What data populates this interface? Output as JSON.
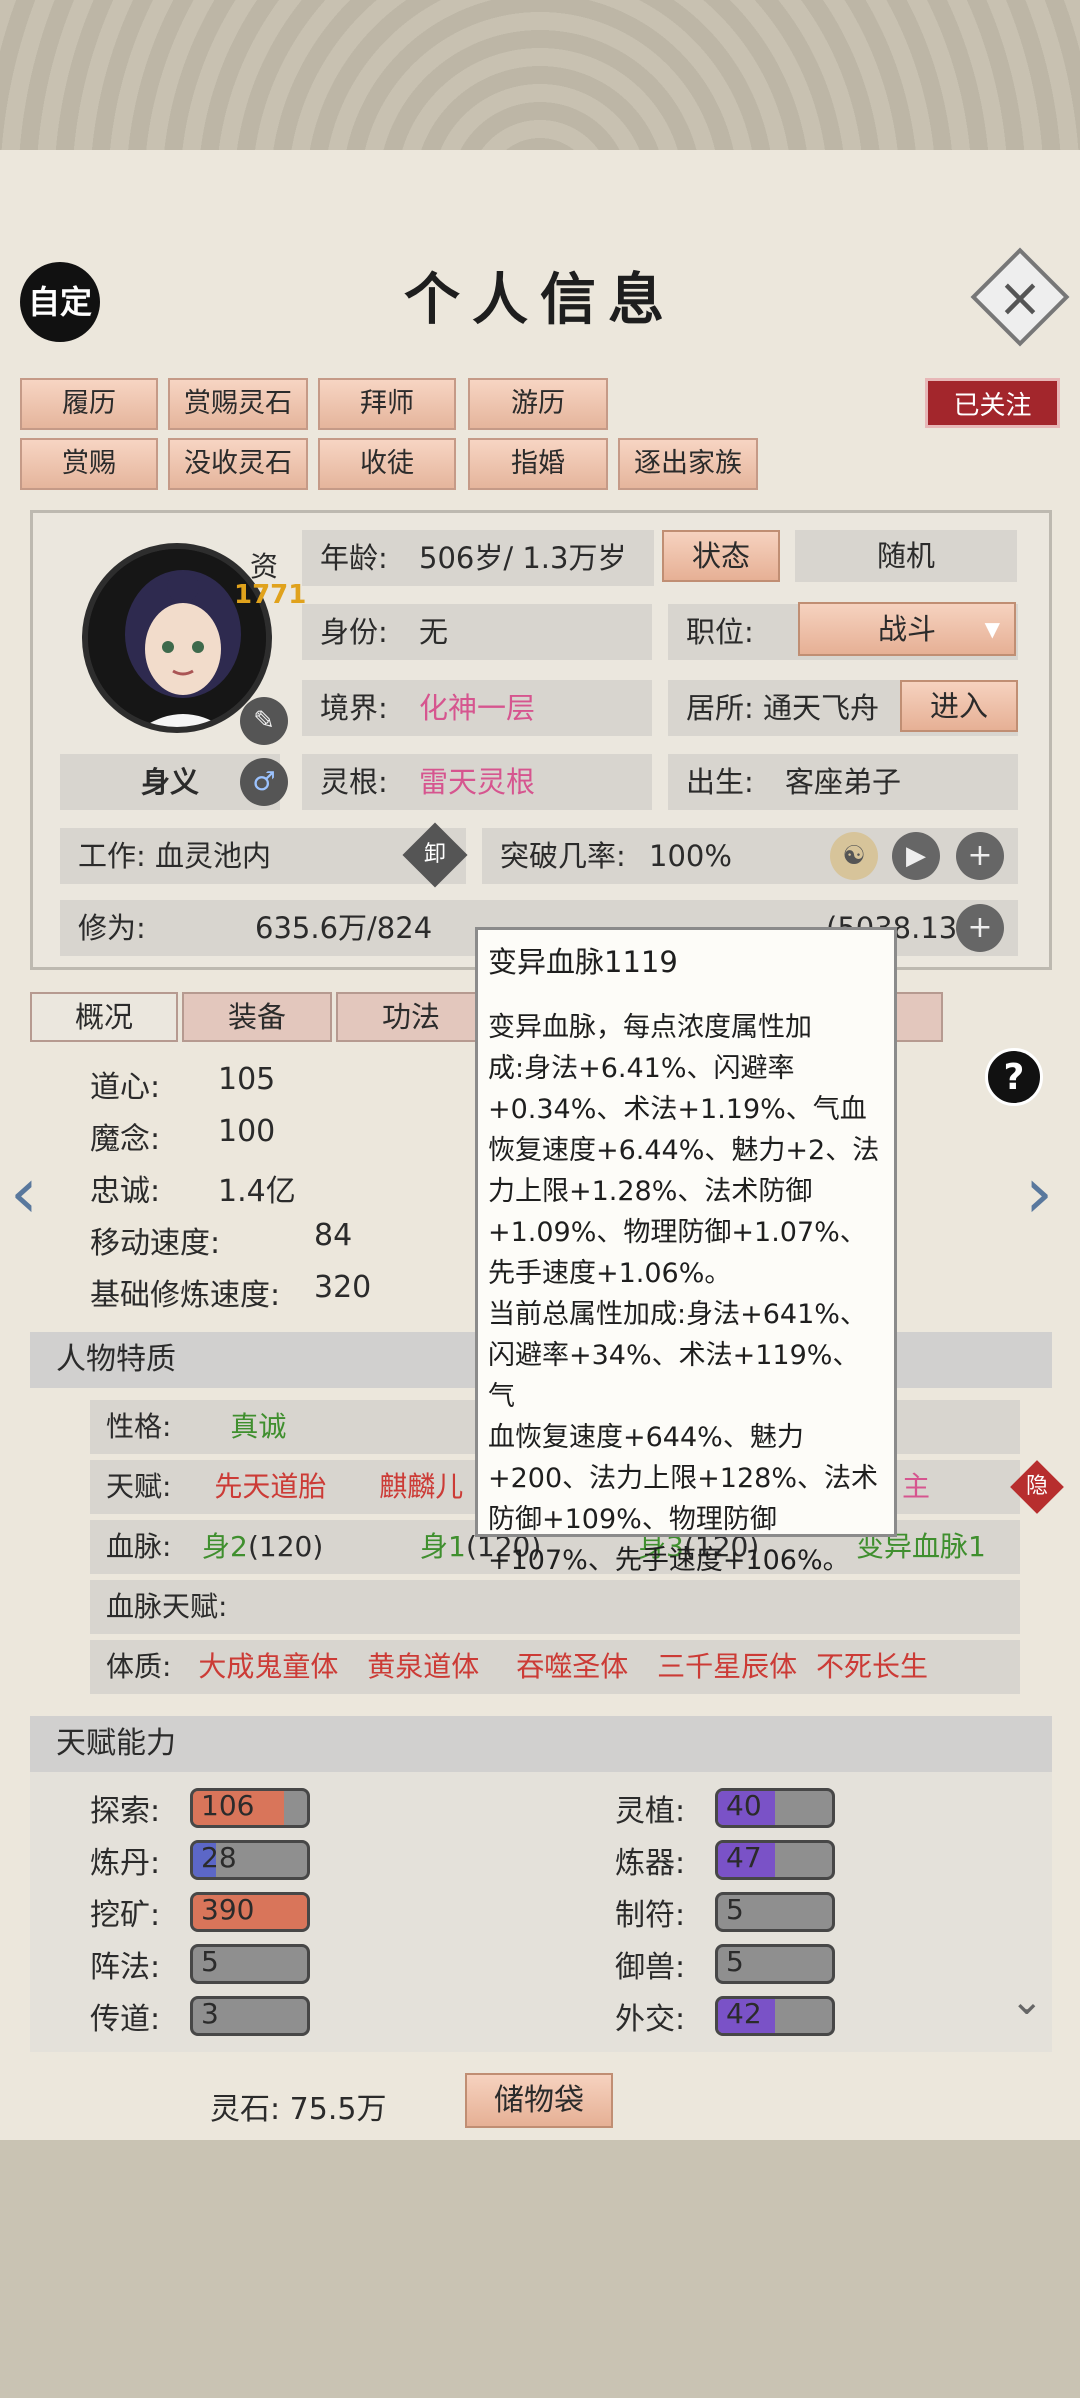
{
  "header": {
    "title": "个人信息",
    "auto_label": "自定",
    "close_icon": "close-icon",
    "follow_label": "已关注"
  },
  "actions": [
    "履历",
    "赏赐灵石",
    "拜师",
    "游历",
    "赏赐",
    "没收灵石",
    "收徒",
    "指婚",
    "逐出家族"
  ],
  "profile": {
    "aptitude_label": "资",
    "aptitude_value": "1771",
    "name": "身义",
    "gender_icon": "male-icon",
    "age_label": "年龄:",
    "age_value": "506岁/ 1.3万岁",
    "status_button": "状态",
    "random_button": "随机",
    "identity_label": "身份:",
    "identity_value": "无",
    "position_label": "职位:",
    "position_value": "战斗",
    "realm_label": "境界:",
    "realm_value": "化神一层",
    "residence_label": "居所:",
    "residence_value": "通天飞舟",
    "enter_button": "进入",
    "root_label": "灵根:",
    "root_value": "雷天灵根",
    "birth_label": "出生:",
    "birth_value": "客座弟子",
    "work_label": "工作:",
    "work_value": "血灵池内",
    "work_badge": "卸",
    "breakthrough_label": "突破几率:",
    "breakthrough_value": "100%",
    "cultivation_label": "修为:",
    "cultivation_value": "635.6万/824",
    "cultivation_tail": "(5038.13%)"
  },
  "tabs": [
    "概况",
    "装备",
    "功法"
  ],
  "stats": [
    {
      "label": "道心:",
      "value": "105"
    },
    {
      "label": "魔念:",
      "value": "100"
    },
    {
      "label": "忠诚:",
      "value": "1.4亿"
    },
    {
      "label": "移动速度:",
      "value": "84"
    },
    {
      "label": "基础修炼速度:",
      "value": "320"
    }
  ],
  "traits": {
    "section_title": "人物特质",
    "personality_label": "性格:",
    "personality_value": "真诚",
    "talent_label": "天赋:",
    "talents": [
      "先天道胎",
      "麒麟儿"
    ],
    "talent_tail": "主",
    "hide_badge": "隐",
    "bloodline_label": "血脉:",
    "bloodlines": [
      {
        "name": "身2",
        "value": "(120)"
      },
      {
        "name": "身1",
        "value": "(120)"
      },
      {
        "name": "身3",
        "value": "(120)"
      },
      {
        "name": "变异血脉1",
        "value": ""
      }
    ],
    "bloodline_talent_label": "血脉天赋:",
    "physique_label": "体质:",
    "physiques": [
      "大成鬼童体",
      "黄泉道体",
      "吞噬圣体",
      "三千星辰体",
      "不死长生"
    ]
  },
  "abilities": {
    "section_title": "天赋能力",
    "left": [
      {
        "label": "探索:",
        "value": "106",
        "level": 0.8,
        "color": "#d9755a"
      },
      {
        "label": "炼丹:",
        "value": "28",
        "level": 0.2,
        "color": "#5c67c7"
      },
      {
        "label": "挖矿:",
        "value": "390",
        "level": 1.0,
        "color": "#d9755a"
      },
      {
        "label": "阵法:",
        "value": "5",
        "level": 0.0,
        "color": "#8f8f8f"
      },
      {
        "label": "传道:",
        "value": "3",
        "level": 0.0,
        "color": "#8f8f8f"
      }
    ],
    "right": [
      {
        "label": "灵植:",
        "value": "40",
        "level": 0.5,
        "color": "#7a52c7"
      },
      {
        "label": "炼器:",
        "value": "47",
        "level": 0.5,
        "color": "#7a52c7"
      },
      {
        "label": "制符:",
        "value": "5",
        "level": 0.0,
        "color": "#8f8f8f"
      },
      {
        "label": "御兽:",
        "value": "5",
        "level": 0.0,
        "color": "#8f8f8f"
      },
      {
        "label": "外交:",
        "value": "42",
        "level": 0.5,
        "color": "#7a52c7"
      }
    ]
  },
  "footer": {
    "spirit_stone_label": "灵石:",
    "spirit_stone_value": "75.5万",
    "bag_button": "储物袋"
  },
  "tooltip": {
    "title": "变异血脉1119",
    "lines": [
      "变异血脉，每点浓度属性加",
      "成:身法+6.41%、闪避率",
      "+0.34%、术法+1.19%、气血",
      "恢复速度+6.44%、魅力+2、法",
      "力上限+1.28%、法术防御",
      "+1.09%、物理防御+1.07%、",
      "先手速度+1.06%。",
      "当前总属性加成:身法+641%、",
      "闪避率+34%、术法+119%、气",
      "血恢复速度+644%、魅力",
      "+200、法力上限+128%、法术",
      "防御+109%、物理防御",
      "+107%、先手速度+106%。"
    ]
  }
}
